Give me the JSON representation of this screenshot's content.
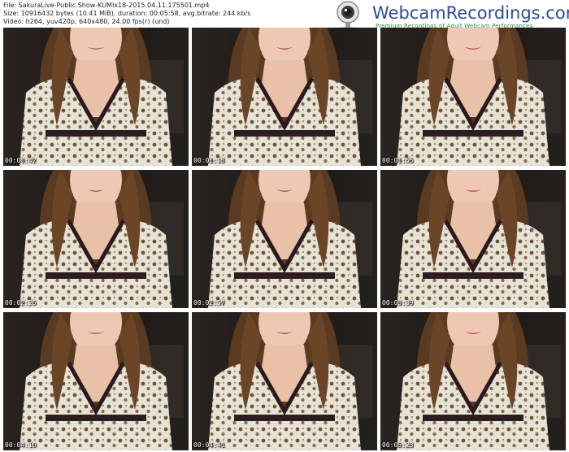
{
  "header": {
    "file": "File: SakuraLive-Public.Show-KUMIx18-2015.04.11.175501.mp4",
    "size": "Size: 10916432 bytes (10.41 MiB), duration: 00:05:58, avg.bitrate: 244 kb/s",
    "video": "Video: h264, yuv420p, 640x480, 24.00 fps(r) (und)"
  },
  "logo": {
    "name": "WebcamRecordings.com",
    "tagline": "Premium Recordings of Adult Webcam Performances",
    "icon": "webcam-icon"
  },
  "frames": [
    {
      "timestamp": "00:00:42"
    },
    {
      "timestamp": "00:01:13"
    },
    {
      "timestamp": "00:01:55"
    },
    {
      "timestamp": "00:02:26"
    },
    {
      "timestamp": "00:02:57"
    },
    {
      "timestamp": "00:03:39"
    },
    {
      "timestamp": "00:04:10"
    },
    {
      "timestamp": "00:04:41"
    },
    {
      "timestamp": "00:05:23"
    }
  ],
  "colors": {
    "background": "#ffffff",
    "logo_text": "#2b4c9a",
    "logo_tagline": "#2f8f3a",
    "timestamp": "#ffffff"
  }
}
